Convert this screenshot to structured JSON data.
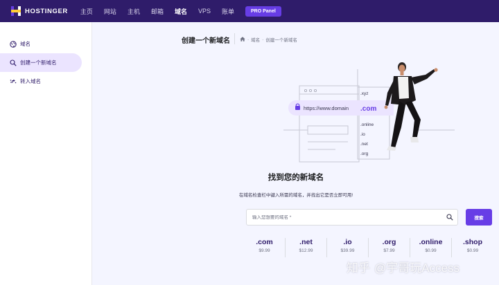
{
  "brand": {
    "name": "HOSTINGER",
    "colors": {
      "header_bg": "#2f1c6a",
      "accent": "#673de6",
      "logo_yellow": "#ffcd35"
    }
  },
  "nav": {
    "items": [
      {
        "label": "主页"
      },
      {
        "label": "网站"
      },
      {
        "label": "主机"
      },
      {
        "label": "邮箱"
      },
      {
        "label": "域名"
      },
      {
        "label": "VPS"
      },
      {
        "label": "账单"
      }
    ],
    "active": "域名",
    "pro_panel_label": "PRO Panel"
  },
  "sidebar": {
    "items": [
      {
        "label": "域名",
        "icon": "globe-icon"
      },
      {
        "label": "创建一个新域名",
        "icon": "search-icon",
        "active": true
      },
      {
        "label": "转入域名",
        "icon": "transfer-icon"
      }
    ]
  },
  "page": {
    "title": "创建一个新域名",
    "breadcrumb": [
      "域名",
      "创建一个新域名"
    ]
  },
  "illustration": {
    "url_text": "https://www.domain",
    "tld_list": [
      ".xyz",
      ".com",
      ".online",
      ".io",
      ".net",
      ".org"
    ],
    "highlight_tld": ".com"
  },
  "hero": {
    "title": "找到您的新域名",
    "subtitle": "在域名检查栏中键入所需的域名，并找出它是否立即可用!"
  },
  "search": {
    "placeholder": "输入您想要的域名 *",
    "button_label": "搜索"
  },
  "tlds": [
    {
      "name": ".com",
      "price": "$9.99"
    },
    {
      "name": ".net",
      "price": "$12.99"
    },
    {
      "name": ".io",
      "price": "$39.99"
    },
    {
      "name": ".org",
      "price": "$7.99"
    },
    {
      "name": ".online",
      "price": "$0.99"
    },
    {
      "name": ".shop",
      "price": "$0.99"
    }
  ],
  "watermark": {
    "part1": "知乎",
    "part2": "@宇哥玩Access"
  }
}
